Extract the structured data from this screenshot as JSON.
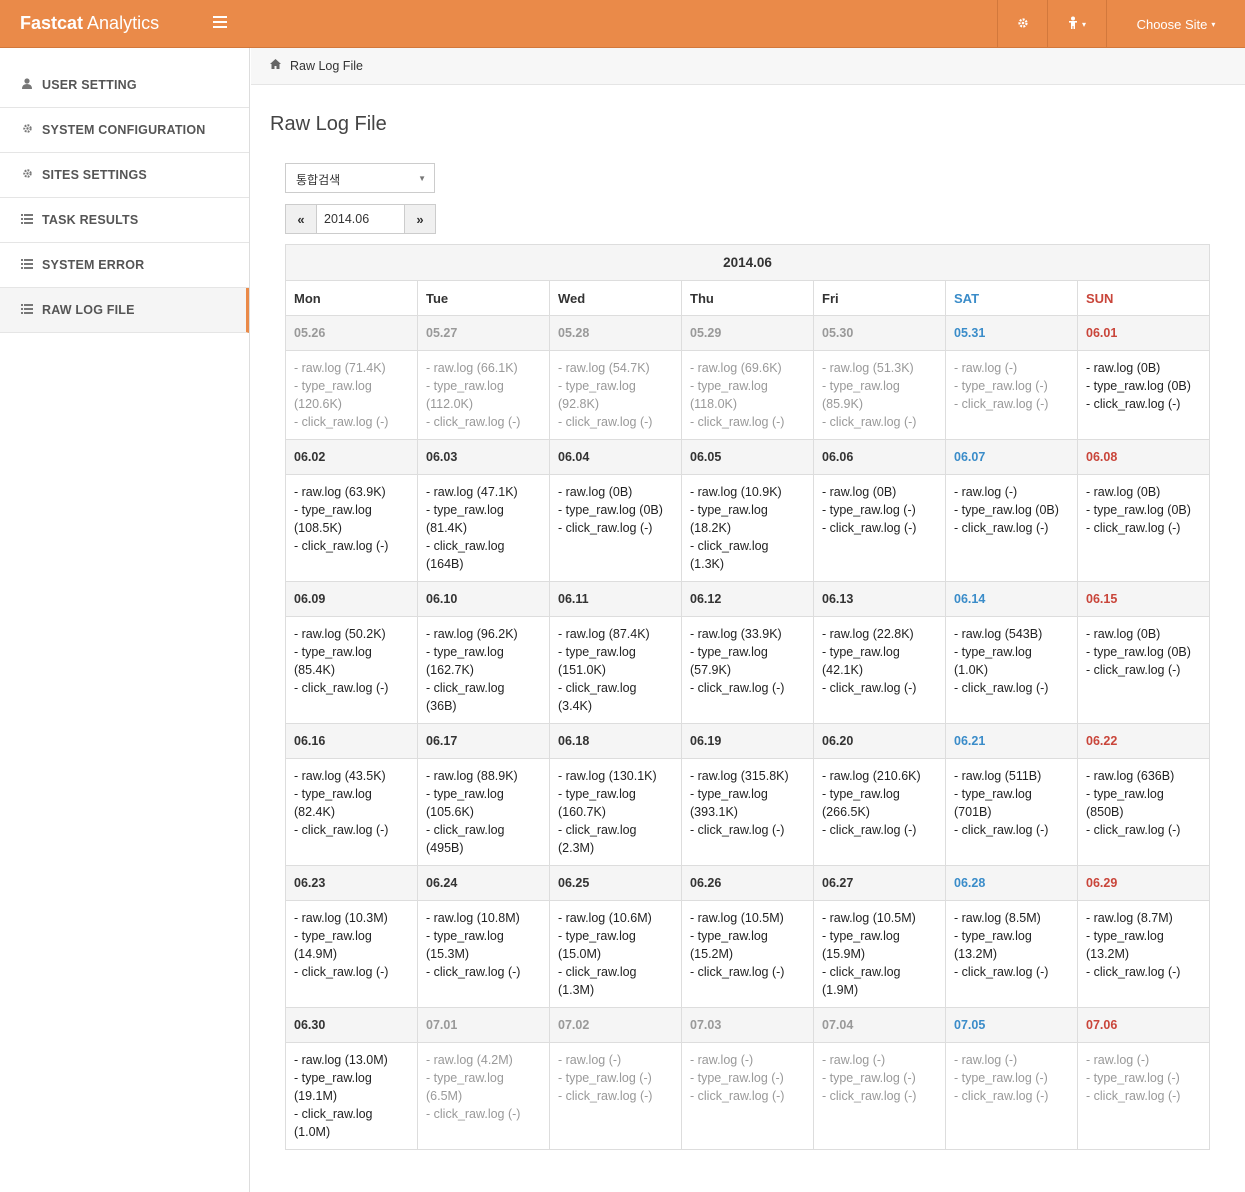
{
  "app": {
    "brand_bold": "Fastcat",
    "brand_rest": " Analytics",
    "choose_site": "Choose Site"
  },
  "sidebar": {
    "items": [
      {
        "label": "USER SETTING",
        "icon": "user-icon"
      },
      {
        "label": "SYSTEM CONFIGURATION",
        "icon": "gear-icon"
      },
      {
        "label": "SITES SETTINGS",
        "icon": "gear-icon"
      },
      {
        "label": "TASK RESULTS",
        "icon": "list-icon"
      },
      {
        "label": "SYSTEM ERROR",
        "icon": "list-icon"
      },
      {
        "label": "RAW LOG FILE",
        "icon": "list-icon"
      }
    ]
  },
  "breadcrumb": {
    "label": "Raw Log File"
  },
  "page": {
    "title": "Raw Log File",
    "select_value": "통합검색",
    "prev_label": "«",
    "next_label": "»",
    "month_value": "2014.06"
  },
  "calendar": {
    "title": "2014.06",
    "weekdays": [
      "Mon",
      "Tue",
      "Wed",
      "Thu",
      "Fri",
      "SAT",
      "SUN"
    ],
    "weeks": [
      {
        "days": [
          {
            "date": "05.26",
            "muted": true,
            "lines": [
              "- raw.log (71.4K)",
              "- type_raw.log",
              "(120.6K)",
              "- click_raw.log (-)"
            ]
          },
          {
            "date": "05.27",
            "muted": true,
            "lines": [
              "- raw.log (66.1K)",
              "- type_raw.log",
              "(112.0K)",
              "- click_raw.log (-)"
            ]
          },
          {
            "date": "05.28",
            "muted": true,
            "lines": [
              "- raw.log (54.7K)",
              "- type_raw.log",
              "(92.8K)",
              "- click_raw.log (-)"
            ]
          },
          {
            "date": "05.29",
            "muted": true,
            "lines": [
              "- raw.log (69.6K)",
              "- type_raw.log",
              "(118.0K)",
              "- click_raw.log (-)"
            ]
          },
          {
            "date": "05.30",
            "muted": true,
            "lines": [
              "- raw.log (51.3K)",
              "- type_raw.log",
              "(85.9K)",
              "- click_raw.log (-)"
            ]
          },
          {
            "date": "05.31",
            "muted": true,
            "lines": [
              "- raw.log (-)",
              "- type_raw.log (-)",
              "- click_raw.log (-)"
            ]
          },
          {
            "date": "06.01",
            "muted": false,
            "lines": [
              "- raw.log (0B)",
              "- type_raw.log (0B)",
              "- click_raw.log (-)"
            ]
          }
        ]
      },
      {
        "days": [
          {
            "date": "06.02",
            "muted": false,
            "lines": [
              "- raw.log (63.9K)",
              "- type_raw.log",
              "(108.5K)",
              "- click_raw.log (-)"
            ]
          },
          {
            "date": "06.03",
            "muted": false,
            "lines": [
              "- raw.log (47.1K)",
              "- type_raw.log",
              "(81.4K)",
              "- click_raw.log",
              "(164B)"
            ]
          },
          {
            "date": "06.04",
            "muted": false,
            "lines": [
              "- raw.log (0B)",
              "- type_raw.log (0B)",
              "- click_raw.log (-)"
            ]
          },
          {
            "date": "06.05",
            "muted": false,
            "lines": [
              "- raw.log (10.9K)",
              "- type_raw.log",
              "(18.2K)",
              "- click_raw.log",
              "(1.3K)"
            ]
          },
          {
            "date": "06.06",
            "muted": false,
            "lines": [
              "- raw.log (0B)",
              "- type_raw.log (-)",
              "- click_raw.log (-)"
            ]
          },
          {
            "date": "06.07",
            "muted": false,
            "lines": [
              "- raw.log (-)",
              "- type_raw.log (0B)",
              "- click_raw.log (-)"
            ]
          },
          {
            "date": "06.08",
            "muted": false,
            "lines": [
              "- raw.log (0B)",
              "- type_raw.log (0B)",
              "- click_raw.log (-)"
            ]
          }
        ]
      },
      {
        "days": [
          {
            "date": "06.09",
            "muted": false,
            "lines": [
              "- raw.log (50.2K)",
              "- type_raw.log",
              "(85.4K)",
              "- click_raw.log (-)"
            ]
          },
          {
            "date": "06.10",
            "muted": false,
            "lines": [
              "- raw.log (96.2K)",
              "- type_raw.log",
              "(162.7K)",
              "- click_raw.log",
              "(36B)"
            ]
          },
          {
            "date": "06.11",
            "muted": false,
            "lines": [
              "- raw.log (87.4K)",
              "- type_raw.log",
              "(151.0K)",
              "- click_raw.log",
              "(3.4K)"
            ]
          },
          {
            "date": "06.12",
            "muted": false,
            "lines": [
              "- raw.log (33.9K)",
              "- type_raw.log",
              "(57.9K)",
              "- click_raw.log (-)"
            ]
          },
          {
            "date": "06.13",
            "muted": false,
            "lines": [
              "- raw.log (22.8K)",
              "- type_raw.log",
              "(42.1K)",
              "- click_raw.log (-)"
            ]
          },
          {
            "date": "06.14",
            "muted": false,
            "lines": [
              "- raw.log (543B)",
              "- type_raw.log",
              "(1.0K)",
              "- click_raw.log (-)"
            ]
          },
          {
            "date": "06.15",
            "muted": false,
            "lines": [
              "- raw.log (0B)",
              "- type_raw.log (0B)",
              "- click_raw.log (-)"
            ]
          }
        ]
      },
      {
        "days": [
          {
            "date": "06.16",
            "muted": false,
            "lines": [
              "- raw.log (43.5K)",
              "- type_raw.log",
              "(82.4K)",
              "- click_raw.log (-)"
            ]
          },
          {
            "date": "06.17",
            "muted": false,
            "lines": [
              "- raw.log (88.9K)",
              "- type_raw.log",
              "(105.6K)",
              "- click_raw.log",
              "(495B)"
            ]
          },
          {
            "date": "06.18",
            "muted": false,
            "lines": [
              "- raw.log (130.1K)",
              "- type_raw.log",
              "(160.7K)",
              "- click_raw.log",
              "(2.3M)"
            ]
          },
          {
            "date": "06.19",
            "muted": false,
            "lines": [
              "- raw.log (315.8K)",
              "- type_raw.log",
              "(393.1K)",
              "- click_raw.log (-)"
            ]
          },
          {
            "date": "06.20",
            "muted": false,
            "lines": [
              "- raw.log (210.6K)",
              "- type_raw.log",
              "(266.5K)",
              "- click_raw.log (-)"
            ]
          },
          {
            "date": "06.21",
            "muted": false,
            "lines": [
              "- raw.log (511B)",
              "- type_raw.log",
              "(701B)",
              "- click_raw.log (-)"
            ]
          },
          {
            "date": "06.22",
            "muted": false,
            "lines": [
              "- raw.log (636B)",
              "- type_raw.log",
              "(850B)",
              "- click_raw.log (-)"
            ]
          }
        ]
      },
      {
        "days": [
          {
            "date": "06.23",
            "muted": false,
            "lines": [
              "- raw.log (10.3M)",
              "- type_raw.log",
              "(14.9M)",
              "- click_raw.log (-)"
            ]
          },
          {
            "date": "06.24",
            "muted": false,
            "lines": [
              "- raw.log (10.8M)",
              "- type_raw.log",
              "(15.3M)",
              "- click_raw.log (-)"
            ]
          },
          {
            "date": "06.25",
            "muted": false,
            "lines": [
              "- raw.log (10.6M)",
              "- type_raw.log",
              "(15.0M)",
              "- click_raw.log",
              "(1.3M)"
            ]
          },
          {
            "date": "06.26",
            "muted": false,
            "lines": [
              "- raw.log (10.5M)",
              "- type_raw.log",
              "(15.2M)",
              "- click_raw.log (-)"
            ]
          },
          {
            "date": "06.27",
            "muted": false,
            "lines": [
              "- raw.log (10.5M)",
              "- type_raw.log",
              "(15.9M)",
              "- click_raw.log",
              "(1.9M)"
            ]
          },
          {
            "date": "06.28",
            "muted": false,
            "lines": [
              "- raw.log (8.5M)",
              "- type_raw.log",
              "(13.2M)",
              "- click_raw.log (-)"
            ]
          },
          {
            "date": "06.29",
            "muted": false,
            "lines": [
              "- raw.log (8.7M)",
              "- type_raw.log",
              "(13.2M)",
              "- click_raw.log (-)"
            ]
          }
        ]
      },
      {
        "days": [
          {
            "date": "06.30",
            "muted": false,
            "lines": [
              "- raw.log (13.0M)",
              "- type_raw.log",
              "(19.1M)",
              "- click_raw.log",
              "(1.0M)"
            ]
          },
          {
            "date": "07.01",
            "muted": true,
            "lines": [
              "- raw.log (4.2M)",
              "- type_raw.log",
              "(6.5M)",
              "- click_raw.log (-)"
            ]
          },
          {
            "date": "07.02",
            "muted": true,
            "lines": [
              "- raw.log (-)",
              "- type_raw.log (-)",
              "- click_raw.log (-)"
            ]
          },
          {
            "date": "07.03",
            "muted": true,
            "lines": [
              "- raw.log (-)",
              "- type_raw.log (-)",
              "- click_raw.log (-)"
            ]
          },
          {
            "date": "07.04",
            "muted": true,
            "lines": [
              "- raw.log (-)",
              "- type_raw.log (-)",
              "- click_raw.log (-)"
            ]
          },
          {
            "date": "07.05",
            "muted": true,
            "lines": [
              "- raw.log (-)",
              "- type_raw.log (-)",
              "- click_raw.log (-)"
            ]
          },
          {
            "date": "07.06",
            "muted": true,
            "lines": [
              "- raw.log (-)",
              "- type_raw.log (-)",
              "- click_raw.log (-)"
            ]
          }
        ]
      }
    ]
  },
  "colors": {
    "accent": "#ea8a49",
    "saturday": "#3a8cc9",
    "sunday": "#c9453a",
    "muted": "#999999"
  }
}
